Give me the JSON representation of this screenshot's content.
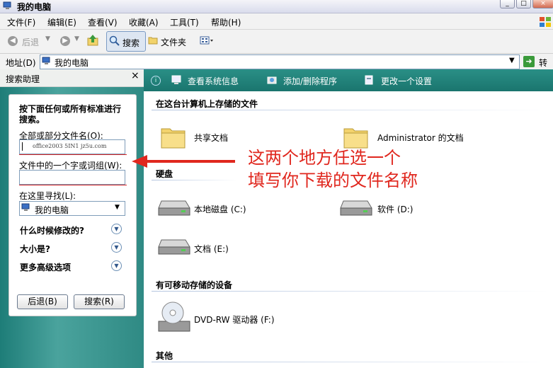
{
  "window": {
    "title": "我的电脑",
    "controls": [
      "_",
      "□",
      "×"
    ]
  },
  "menu": [
    "文件(F)",
    "编辑(E)",
    "查看(V)",
    "收藏(A)",
    "工具(T)",
    "帮助(H)"
  ],
  "toolbar": {
    "back": "后退",
    "search": "搜索",
    "folders": "文件夹"
  },
  "address": {
    "label": "地址(D)",
    "value": "我的电脑",
    "go": "转到"
  },
  "search_panel": {
    "header": "搜索助理",
    "close": "×",
    "intro": "按下面任何或所有标准进行搜索。",
    "name_label": "全部或部分文件名(O):",
    "name_value": "office2003 5IN1 jz5u.com",
    "word_label": "文件中的一个字或词组(W):",
    "word_value": "",
    "look_label": "在这里寻找(L):",
    "look_value": "我的电脑",
    "when_modified": "什么时候修改的?",
    "size": "大小是?",
    "advanced": "更多高级选项",
    "back_button": "后退(B)",
    "search_button": "搜索(R)"
  },
  "tasks": {
    "view_info": "查看系统信息",
    "add_remove": "添加/删除程序",
    "change_setting": "更改一个设置"
  },
  "sections": {
    "stored_files": "在这台计算机上存储的文件",
    "hard_disks": "硬盘",
    "removable": "有可移动存储的设备",
    "other": "其他"
  },
  "items": {
    "shared_docs": "共享文档",
    "admin_docs": "Administrator 的文档",
    "local_disk_c": "本地磁盘 (C:)",
    "software_d": "软件 (D:)",
    "docs_e": "文档 (E:)",
    "dvd_f": "DVD-RW 驱动器 (F:)"
  },
  "annotation": {
    "line1": "这两个地方任选一个",
    "line2": "填写你下载的文件名称"
  },
  "colors": {
    "annotation": "#e0271e",
    "left_pane": "#2f8a84",
    "task_bar": "#1a756e"
  }
}
